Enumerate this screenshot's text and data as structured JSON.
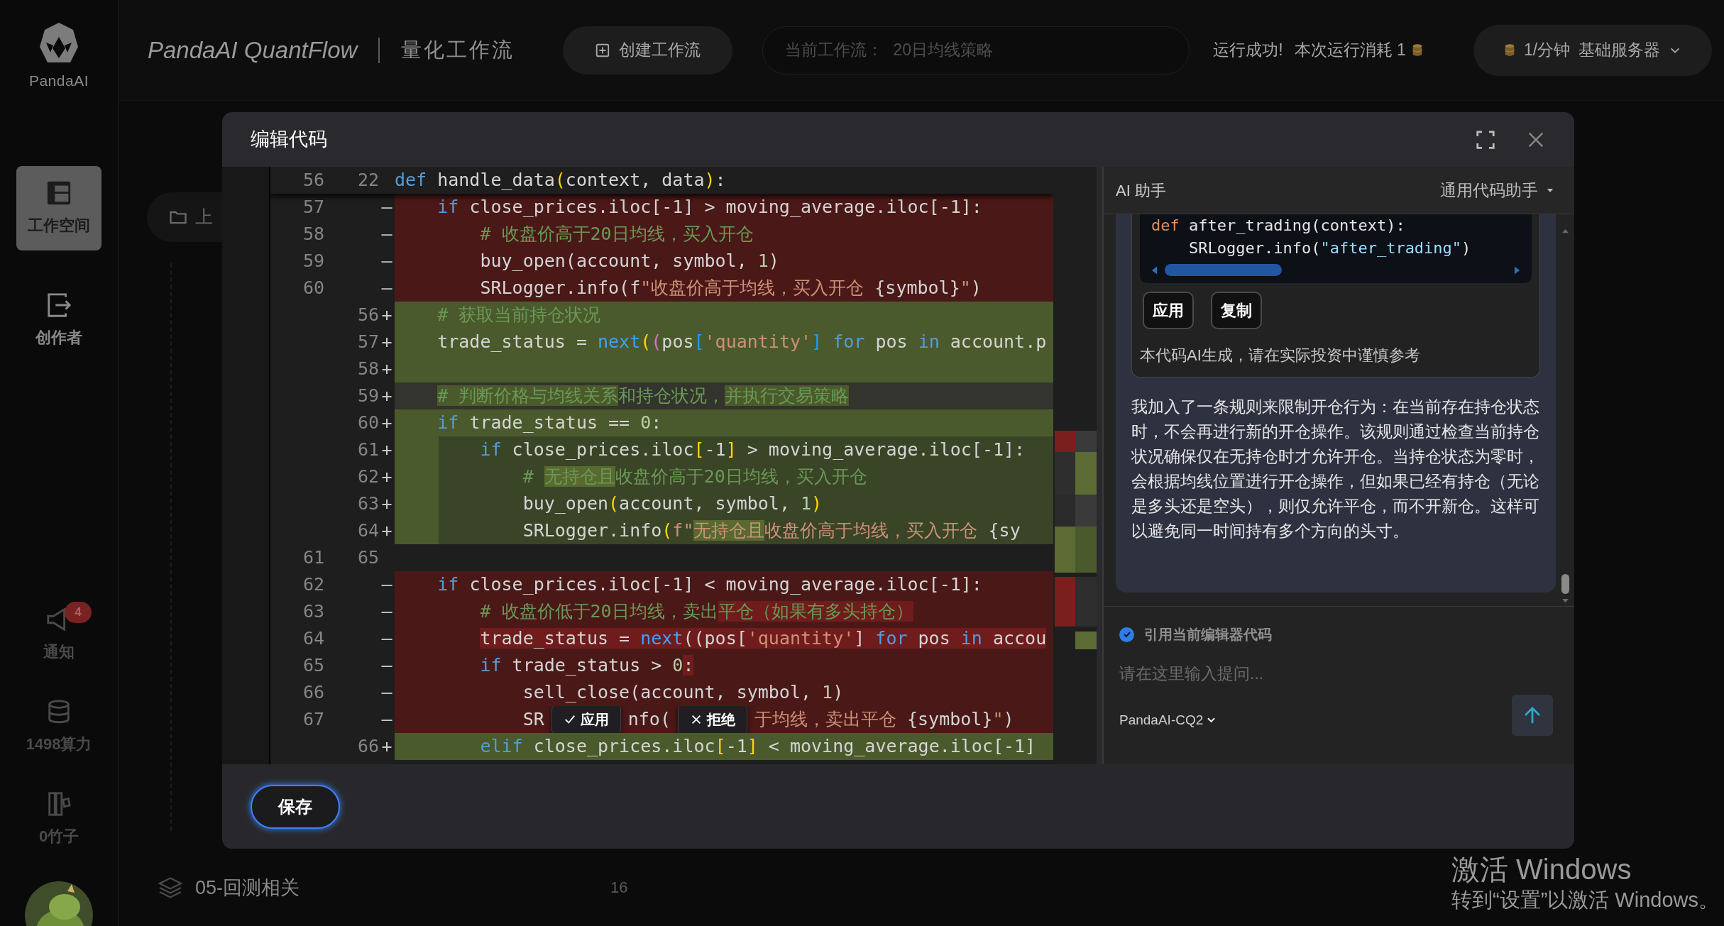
{
  "app": {
    "logo_text": "PandaAI",
    "title": "PandaAI QuantFlow",
    "subtitle": "量化工作流"
  },
  "toolbar": {
    "create_button": "创建工作流",
    "current_workflow": {
      "label": "当前工作流：",
      "value": "20日均线策略"
    },
    "run_status": "运行成功!",
    "run_cost": "本次运行消耗 1",
    "server": {
      "rate": "1/分钟",
      "name": "基础服务器"
    }
  },
  "sidebar": {
    "items": [
      {
        "kind": "workspace",
        "label": "工作空间",
        "selected": true,
        "dimmed": false
      },
      {
        "kind": "creator",
        "label": "创作者",
        "selected": false,
        "dimmed": false
      },
      {
        "kind": "notice",
        "label": "通知",
        "badge": "4",
        "selected": false,
        "dimmed": true
      },
      {
        "kind": "compute",
        "label": "1498算力",
        "selected": false,
        "dimmed": true
      },
      {
        "kind": "bamboo",
        "label": "0竹子",
        "selected": false,
        "dimmed": true
      }
    ]
  },
  "canvas": {
    "folder_label": "上",
    "group": {
      "label": "05-回测相关",
      "count": "16"
    }
  },
  "dialog": {
    "title": "编辑代码",
    "editor": {
      "rows": [
        {
          "kind": "sticky",
          "old": "56",
          "new": "22",
          "code": [
            {
              "text": "def",
              "kind": "kw"
            },
            {
              "text": " handle_data",
              "kind": "plain"
            },
            {
              "text": "(",
              "kind": "b1"
            },
            {
              "text": "context, data",
              "kind": "plain"
            },
            {
              "text": ")",
              "kind": "b1"
            },
            {
              "text": ":",
              "kind": "plain"
            }
          ]
        },
        {
          "kind": "deleted",
          "old": "57",
          "sign": "—",
          "code": [
            {
              "text": "    if",
              "kind": "kw"
            },
            {
              "text": " close_prices.iloc[-1] > moving_average.iloc[-1]:",
              "kind": "plain"
            }
          ]
        },
        {
          "kind": "deleted",
          "old": "58",
          "sign": "—",
          "code": [
            {
              "text": "        # 收盘价高于20日均线，买入开仓",
              "kind": "comment"
            }
          ]
        },
        {
          "kind": "deleted",
          "old": "59",
          "sign": "—",
          "code": [
            {
              "text": "        buy_open(account, symbol, ",
              "kind": "plain"
            },
            {
              "text": "1",
              "kind": "num"
            },
            {
              "text": ")",
              "kind": "plain"
            }
          ]
        },
        {
          "kind": "deleted",
          "old": "60",
          "sign": "—",
          "code": [
            {
              "text": "        SRLogger.info(f",
              "kind": "plain"
            },
            {
              "text": "\"收盘价高于均线，买入开仓 ",
              "kind": "str"
            },
            {
              "text": "{symbol}",
              "kind": "plain"
            },
            {
              "text": "\"",
              "kind": "str"
            },
            {
              "text": ")",
              "kind": "plain"
            }
          ]
        },
        {
          "kind": "added",
          "new": "56",
          "sign": "+",
          "code": [
            {
              "text": "    # 获取当前持仓状况",
              "kind": "comment"
            }
          ]
        },
        {
          "kind": "added",
          "new": "57",
          "sign": "+",
          "code": [
            {
              "text": "    trade_status = ",
              "kind": "plain"
            },
            {
              "text": "next",
              "kind": "fn"
            },
            {
              "text": "(",
              "kind": "b1"
            },
            {
              "text": "(",
              "kind": "b2"
            },
            {
              "text": "pos",
              "kind": "plain"
            },
            {
              "text": "[",
              "kind": "b3"
            },
            {
              "text": "'quantity'",
              "kind": "str"
            },
            {
              "text": "]",
              "kind": "b3"
            },
            {
              "text": " for",
              "kind": "kw"
            },
            {
              "text": " pos ",
              "kind": "plain"
            },
            {
              "text": "in",
              "kind": "kw"
            },
            {
              "text": " account.p",
              "kind": "plain"
            }
          ]
        },
        {
          "kind": "added",
          "new": "58",
          "sign": "+",
          "code": []
        },
        {
          "kind": "added-dim",
          "new": "59",
          "sign": "+",
          "code": [
            {
              "text": "    # 判断价格与均线关系",
              "kind": "comment",
              "highlight": true
            },
            {
              "text": "和持仓状况，",
              "kind": "comment",
              "highlight": false
            },
            {
              "text": "并执行交易策略",
              "kind": "comment",
              "highlight": true
            }
          ]
        },
        {
          "kind": "added",
          "new": "60",
          "sign": "+",
          "code": [
            {
              "text": "    if",
              "kind": "kw"
            },
            {
              "text": " trade_status == ",
              "kind": "plain"
            },
            {
              "text": "0",
              "kind": "num"
            },
            {
              "text": ":",
              "kind": "plain"
            }
          ]
        },
        {
          "kind": "added-nested",
          "new": "61",
          "sign": "+",
          "code": [
            {
              "text": "        if",
              "kind": "kw"
            },
            {
              "text": " close_prices.iloc",
              "kind": "plain"
            },
            {
              "text": "[",
              "kind": "b1"
            },
            {
              "text": "-1",
              "kind": "plain"
            },
            {
              "text": "]",
              "kind": "b1"
            },
            {
              "text": " > moving_average.iloc[-1]:",
              "kind": "plain"
            }
          ]
        },
        {
          "kind": "added-nested",
          "new": "62",
          "sign": "+",
          "code": [
            {
              "text": "            # ",
              "kind": "comment",
              "highlight": false
            },
            {
              "text": "无持仓且",
              "kind": "comment",
              "highlight": true
            },
            {
              "text": "收盘价高于20日均线，买入开仓",
              "kind": "comment",
              "highlight": false
            }
          ]
        },
        {
          "kind": "added-nested",
          "new": "63",
          "sign": "+",
          "code": [
            {
              "text": "            buy_open",
              "kind": "plain"
            },
            {
              "text": "(",
              "kind": "b1"
            },
            {
              "text": "account, symbol, ",
              "kind": "plain"
            },
            {
              "text": "1",
              "kind": "num"
            },
            {
              "text": ")",
              "kind": "b1"
            }
          ]
        },
        {
          "kind": "added-nested",
          "new": "64",
          "sign": "+",
          "code": [
            {
              "text": "            SRLogger.info",
              "kind": "plain"
            },
            {
              "text": "(",
              "kind": "b1"
            },
            {
              "text": "f\"",
              "kind": "str",
              "highlight": false
            },
            {
              "text": "无持仓且",
              "kind": "str",
              "highlight": true
            },
            {
              "text": "收盘价高于均线，买入开仓 ",
              "kind": "str",
              "highlight": false
            },
            {
              "text": "{sy",
              "kind": "plain",
              "highlight": false
            }
          ]
        },
        {
          "kind": "context",
          "old": "61",
          "new": "65",
          "code": []
        },
        {
          "kind": "deleted",
          "old": "62",
          "sign": "—",
          "code": [
            {
              "text": "    if",
              "kind": "kw"
            },
            {
              "text": " close_prices.iloc[-1] < moving_average.iloc[-1]:",
              "kind": "plain"
            }
          ]
        },
        {
          "kind": "deleted",
          "old": "63",
          "sign": "—",
          "code": [
            {
              "text": "        # 收盘价低于20日均线，卖出",
              "kind": "comment",
              "highlight": false
            },
            {
              "text": "平仓（如果有多头持仓）",
              "kind": "comment",
              "highlight": true
            }
          ]
        },
        {
          "kind": "deleted",
          "old": "64",
          "sign": "—",
          "code": [
            {
              "text": "        trade_status = ",
              "kind": "plain",
              "highlight": true
            },
            {
              "text": "next",
              "kind": "fn",
              "highlight": true
            },
            {
              "text": "((pos[",
              "kind": "plain",
              "highlight": true
            },
            {
              "text": "'quantity'",
              "kind": "str",
              "highlight": true
            },
            {
              "text": "] ",
              "kind": "plain",
              "highlight": true
            },
            {
              "text": "for",
              "kind": "kw",
              "highlight": true
            },
            {
              "text": " pos ",
              "kind": "plain",
              "highlight": true
            },
            {
              "text": "in",
              "kind": "kw",
              "highlight": true
            },
            {
              "text": " accou",
              "kind": "plain",
              "highlight": true
            }
          ]
        },
        {
          "kind": "deleted",
          "old": "65",
          "sign": "—",
          "code": [
            {
              "text": "        if",
              "kind": "kw",
              "highlight": false
            },
            {
              "text": " trade_status > ",
              "kind": "plain",
              "highlight": false
            },
            {
              "text": "0",
              "kind": "num",
              "highlight": false
            },
            {
              "text": ":",
              "kind": "plain",
              "highlight": true
            }
          ]
        },
        {
          "kind": "deleted",
          "old": "66",
          "sign": "—",
          "code": [
            {
              "text": "            sell_close(account, symbol, ",
              "kind": "plain"
            },
            {
              "text": "1",
              "kind": "num"
            },
            {
              "text": ")",
              "kind": "plain"
            }
          ]
        },
        {
          "kind": "deleted",
          "old": "67",
          "sign": "—",
          "code": [
            {
              "text": "            SR",
              "kind": "plain"
            },
            {
              "text": "应用",
              "kind": "accept"
            },
            {
              "text": "nfo(",
              "kind": "plain"
            },
            {
              "text": "拒绝",
              "kind": "reject"
            },
            {
              "text": "于均线，卖出平仓 ",
              "kind": "str"
            },
            {
              "text": "{symbol}",
              "kind": "plain"
            },
            {
              "text": "\"",
              "kind": "str"
            },
            {
              "text": ")",
              "kind": "plain"
            }
          ]
        },
        {
          "kind": "added",
          "new": "66",
          "sign": "+",
          "code": [
            {
              "text": "        elif",
              "kind": "kw"
            },
            {
              "text": " close_prices.iloc",
              "kind": "plain"
            },
            {
              "text": "[",
              "kind": "b1"
            },
            {
              "text": "-1",
              "kind": "plain"
            },
            {
              "text": "]",
              "kind": "b1"
            },
            {
              "text": " < moving_average.iloc[-1]",
              "kind": "plain"
            }
          ]
        }
      ]
    },
    "assistant": {
      "title": "AI 助手",
      "mode": "通用代码助手",
      "message": {
        "code_lines": [
          [
            {
              "text": "def",
              "kind": "kw"
            },
            {
              "text": " after_trading(context):",
              "kind": "plain"
            }
          ],
          [
            {
              "text": "    SRLogger.info(",
              "kind": "plain"
            },
            {
              "text": "\"after_trading\"",
              "kind": "str"
            },
            {
              "text": ")",
              "kind": "plain"
            }
          ]
        ],
        "actions": [
          "应用",
          "复制"
        ],
        "disclaimer": "本代码AI生成，请在实际投资中谨慎参考",
        "reply": "我加入了一条规则来限制开仓行为：在当前存在持仓状态时，不会再进行新的开仓操作。该规则通过检查当前持仓状况确保仅在无持仓时才允许开仓。当持仓状态为零时，会根据均线位置进行开仓操作，但如果已经有持仓（无论是多头还是空头），则仅允许平仓，而不开新仓。这样可以避免同一时间持有多个方向的头寸。"
      },
      "include_code": {
        "label": "引用当前编辑器代码",
        "checked": true
      },
      "input": {
        "placeholder": "请在这里输入提问..."
      },
      "model": "PandaAI-CQ2"
    },
    "save_button": "保存"
  },
  "os_notice": {
    "title": "激活 Windows",
    "hint": "转到“设置”以激活 Windows。"
  }
}
